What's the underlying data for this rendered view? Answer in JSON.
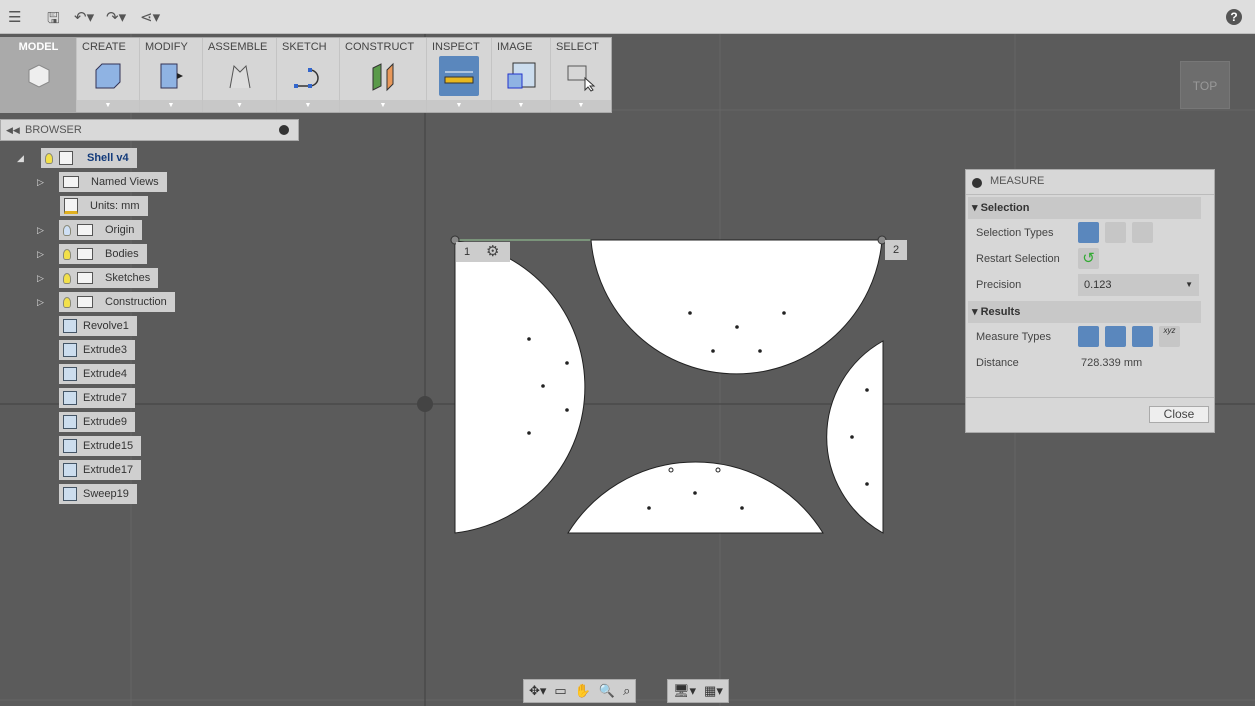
{
  "topbar": {
    "icons": [
      "menu-icon",
      "save-icon",
      "undo-icon",
      "redo-icon",
      "share-icon",
      "help-icon"
    ]
  },
  "toolbar": {
    "model": "MODEL",
    "tools": [
      "CREATE",
      "MODIFY",
      "ASSEMBLE",
      "SKETCH",
      "CONSTRUCT",
      "INSPECT",
      "IMAGE",
      "SELECT"
    ],
    "active": "INSPECT"
  },
  "viewcube": {
    "label": "TOP"
  },
  "browser": {
    "title": "BROWSER",
    "root": "Shell v4",
    "items": [
      {
        "label": "Named Views"
      },
      {
        "label": "Units: mm"
      },
      {
        "label": "Origin"
      },
      {
        "label": "Bodies"
      },
      {
        "label": "Sketches"
      },
      {
        "label": "Construction"
      },
      {
        "label": "Revolve1"
      },
      {
        "label": "Extrude3"
      },
      {
        "label": "Extrude4"
      },
      {
        "label": "Extrude7"
      },
      {
        "label": "Extrude9"
      },
      {
        "label": "Extrude15"
      },
      {
        "label": "Extrude17"
      },
      {
        "label": "Sweep19"
      }
    ]
  },
  "markers": {
    "p1": "1",
    "p2": "2"
  },
  "measure": {
    "title": "MEASURE",
    "selection": "Selection",
    "selection_types": "Selection Types",
    "restart": "Restart Selection",
    "precision_label": "Precision",
    "precision": "0.123",
    "results": "Results",
    "measure_types": "Measure Types",
    "distance_label": "Distance",
    "distance": "728.339 mm",
    "close": "Close"
  }
}
